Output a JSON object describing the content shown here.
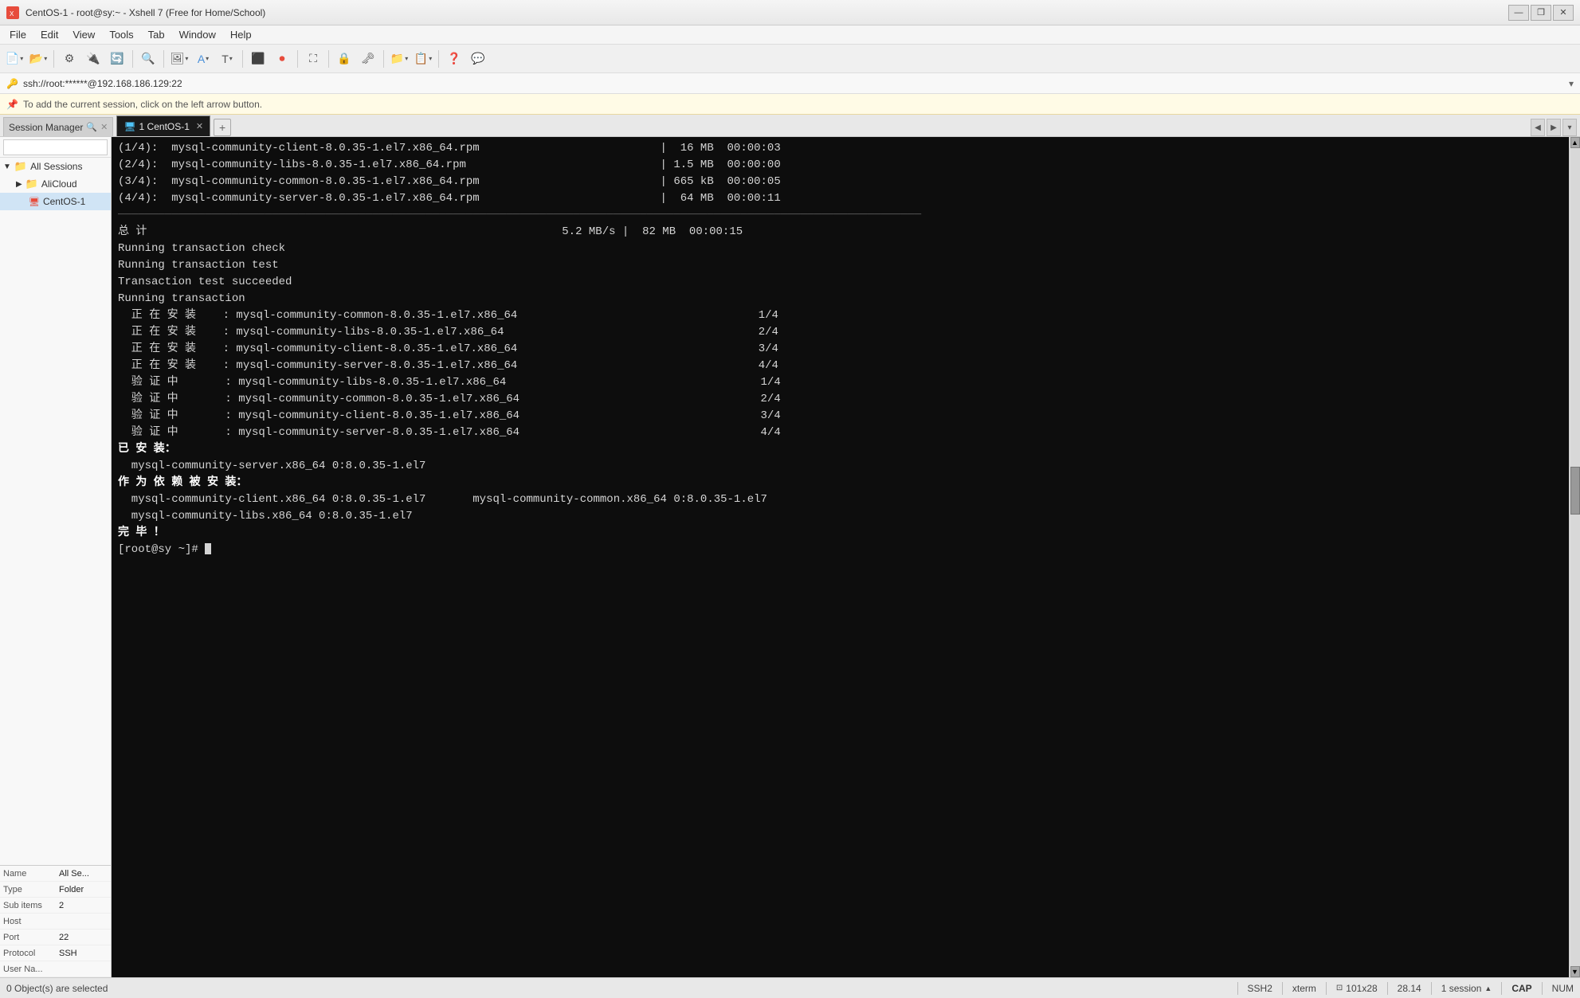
{
  "window": {
    "title": "CentOS-1 - root@sy:~ - Xshell 7 (Free for Home/School)",
    "icon": "🖥"
  },
  "menu": {
    "items": [
      "File",
      "Edit",
      "View",
      "Tools",
      "Tab",
      "Window",
      "Help"
    ]
  },
  "address_bar": {
    "text": "ssh://root:******@192.168.186.129:22",
    "icon": "🔑"
  },
  "hint_bar": {
    "text": "To add the current session, click on the left arrow button.",
    "icon": "📌"
  },
  "tabs": {
    "session_manager": "Session Manager",
    "active_tab": "1 CentOS-1"
  },
  "sidebar": {
    "search_placeholder": "",
    "tree": [
      {
        "label": "All Sessions",
        "type": "folder",
        "indent": 0
      },
      {
        "label": "AliCloud",
        "type": "folder",
        "indent": 1
      },
      {
        "label": "CentOS-1",
        "type": "session",
        "indent": 2
      }
    ]
  },
  "properties": {
    "rows": [
      {
        "key": "Name",
        "value": "All Se..."
      },
      {
        "key": "Type",
        "value": "Folder"
      },
      {
        "key": "Sub items",
        "value": "2"
      },
      {
        "key": "Host",
        "value": ""
      },
      {
        "key": "Port",
        "value": "22"
      },
      {
        "key": "Protocol",
        "value": "SSH"
      },
      {
        "key": "User Na...",
        "value": ""
      }
    ]
  },
  "terminal": {
    "lines": [
      "(1/4):  mysql-community-client-8.0.35-1.el7.x86_64.rpm                           |  16 MB  00:00:03    ",
      "(2/4):  mysql-community-libs-8.0.35-1.el7.x86_64.rpm                             | 1.5 MB  00:00:00    ",
      "(3/4):  mysql-community-common-8.0.35-1.el7.x86_64.rpm                           | 665 kB  00:00:05    ",
      "(4/4):  mysql-community-server-8.0.35-1.el7.x86_64.rpm                           |  64 MB  00:00:11    ",
      "--------------------------------------------------------------------------------",
      "总 计                                                              5.2 MB/s |  82 MB  00:00:15     ",
      "Running transaction check",
      "Running transaction test",
      "Transaction test succeeded",
      "Running transaction",
      "  正 在 安 装    : mysql-community-common-8.0.35-1.el7.x86_64                                    1/4 ",
      "  正 在 安 装    : mysql-community-libs-8.0.35-1.el7.x86_64                                      2/4 ",
      "  正 在 安 装    : mysql-community-client-8.0.35-1.el7.x86_64                                    3/4 ",
      "  正 在 安 装    : mysql-community-server-8.0.35-1.el7.x86_64                                    4/4 ",
      "  验 证 中       : mysql-community-libs-8.0.35-1.el7.x86_64                                      1/4 ",
      "  验 证 中       : mysql-community-common-8.0.35-1.el7.x86_64                                    2/4 ",
      "  验 证 中       : mysql-community-client-8.0.35-1.el7.x86_64                                    3/4 ",
      "  验 证 中       : mysql-community-server-8.0.35-1.el7.x86_64                                    4/4 ",
      "",
      "已 安 装：",
      "  mysql-community-server.x86_64 0:8.0.35-1.el7                                                        ",
      "",
      "作 为 依 赖 被 安 装：",
      "  mysql-community-client.x86_64 0:8.0.35-1.el7       mysql-community-common.x86_64 0:8.0.35-1.el7   ",
      "  mysql-community-libs.x86_64 0:8.0.35-1.el7",
      "",
      "完 毕 ！",
      "[root@sy ~]# "
    ],
    "prompt": "[root@sy ~]# "
  },
  "status_bar": {
    "left": "0 Object(s) are selected",
    "ssh": "SSH2",
    "term": "xterm",
    "size": "101x28",
    "speed": "28.14",
    "sessions": "1 session",
    "cap": "CAP",
    "num": "NUM"
  }
}
